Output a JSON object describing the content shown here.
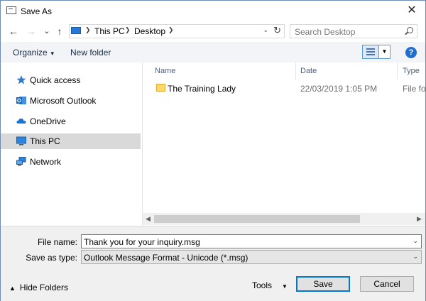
{
  "window": {
    "title": "Save As",
    "close": "✕"
  },
  "nav": {
    "back": "←",
    "forward": "→",
    "recent": "⌄",
    "up": "↑",
    "path": [
      "This PC",
      "Desktop"
    ],
    "refresh": "↻",
    "search_placeholder": "Search Desktop"
  },
  "toolbar": {
    "organize": "Organize",
    "new_folder": "New folder",
    "help": "?"
  },
  "sidebar": {
    "items": [
      {
        "label": "Quick access",
        "icon": "star-icon"
      },
      {
        "label": "Microsoft Outlook",
        "icon": "outlook-icon"
      },
      {
        "label": "OneDrive",
        "icon": "cloud-icon"
      },
      {
        "label": "This PC",
        "icon": "computer-icon",
        "selected": true
      },
      {
        "label": "Network",
        "icon": "network-icon"
      }
    ]
  },
  "files": {
    "columns": {
      "name": "Name",
      "date": "Date",
      "type": "Type"
    },
    "rows": [
      {
        "name": "The Training Lady",
        "date": "22/03/2019 1:05 PM",
        "type": "File fold"
      }
    ]
  },
  "form": {
    "file_name_label": "File name:",
    "file_name_value": "Thank you for your inquiry.msg",
    "save_type_label": "Save as type:",
    "save_type_value": "Outlook Message Format - Unicode (*.msg)"
  },
  "footer": {
    "hide_folders": "Hide Folders",
    "tools": "Tools",
    "save": "Save",
    "cancel": "Cancel"
  },
  "colors": {
    "accent": "#0078d7",
    "selection": "#d9d9d9",
    "folder": "#ffd76a"
  }
}
